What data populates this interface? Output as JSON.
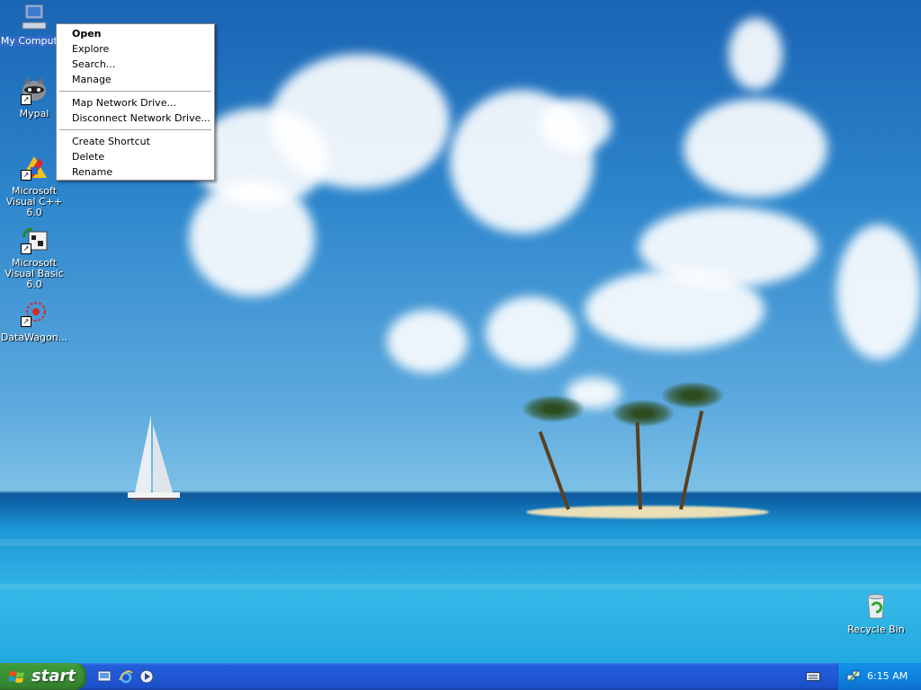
{
  "desktop": {
    "icons": [
      {
        "label": "My Computer",
        "icon": "my-computer-icon",
        "selected": true
      },
      {
        "label": "Mypal",
        "icon": "mypal-raccoon-icon",
        "selected": false
      },
      {
        "label": "Microsoft Visual C++ 6.0",
        "icon": "visual-cpp-icon",
        "selected": false
      },
      {
        "label": "Microsoft Visual Basic 6.0",
        "icon": "visual-basic-icon",
        "selected": false
      },
      {
        "label": "DataWagon...",
        "icon": "datawagon-icon",
        "selected": false
      },
      {
        "label": "Recycle Bin",
        "icon": "recycle-bin-icon",
        "selected": false
      }
    ]
  },
  "context_menu": {
    "groups": [
      [
        {
          "label": "Open",
          "bold": true
        },
        {
          "label": "Explore",
          "bold": false
        },
        {
          "label": "Search...",
          "bold": false
        },
        {
          "label": "Manage",
          "bold": false
        }
      ],
      [
        {
          "label": "Map Network Drive...",
          "bold": false
        },
        {
          "label": "Disconnect Network Drive...",
          "bold": false
        }
      ],
      [
        {
          "label": "Create Shortcut",
          "bold": false
        },
        {
          "label": "Delete",
          "bold": false
        },
        {
          "label": "Rename",
          "bold": false
        }
      ]
    ]
  },
  "taskbar": {
    "start_label": "start",
    "quick_launch": [
      "show-desktop-icon",
      "internet-explorer-icon",
      "media-player-icon"
    ],
    "clock": "6:15 AM"
  },
  "colors": {
    "taskbar_blue": "#245edb",
    "start_green": "#3c9a37",
    "selection_blue": "#316ac5"
  }
}
